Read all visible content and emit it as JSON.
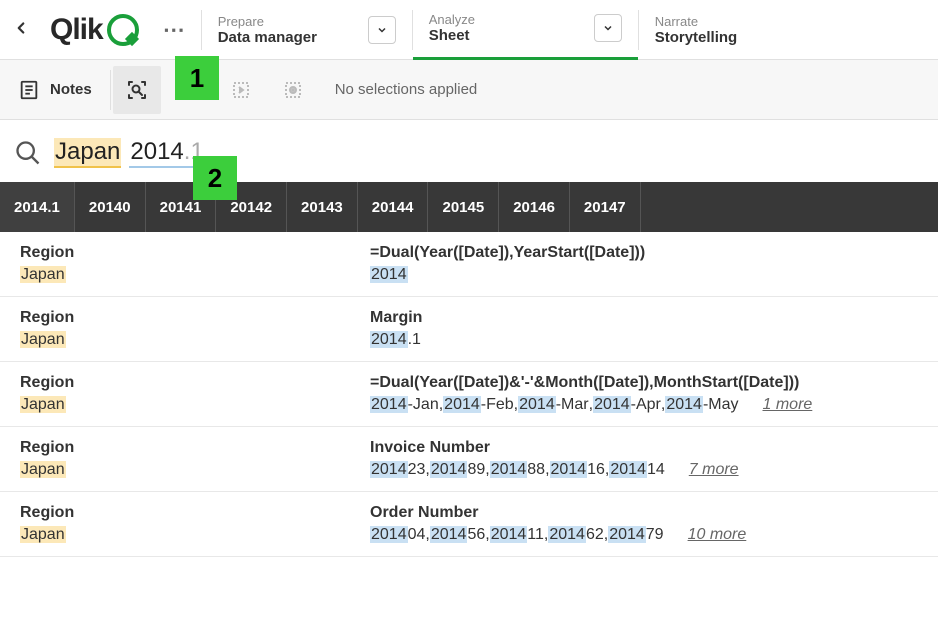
{
  "annotations": {
    "one": "1",
    "two": "2"
  },
  "nav": {
    "prepare_label": "Prepare",
    "prepare_value": "Data manager",
    "analyze_label": "Analyze",
    "analyze_value": "Sheet",
    "narrate_label": "Narrate",
    "narrate_value": "Storytelling"
  },
  "toolbar": {
    "notes": "Notes",
    "no_selections": "No selections applied"
  },
  "search": {
    "term_japan": "Japan",
    "term_2014": "2014",
    "term_suffix": ".1"
  },
  "tabs": [
    "2014.1",
    "20140",
    "20141",
    "20142",
    "20143",
    "20144",
    "20145",
    "20146",
    "20147"
  ],
  "results": [
    {
      "left_field": "Region",
      "left_value": "Japan",
      "right_field": "=Dual(Year([Date]),YearStart([Date]))",
      "right_values": [
        {
          "hl": "2014",
          "rest": ""
        }
      ]
    },
    {
      "left_field": "Region",
      "left_value": "Japan",
      "right_field": "Margin",
      "right_values": [
        {
          "hl": "2014",
          "rest": ".1"
        }
      ]
    },
    {
      "left_field": "Region",
      "left_value": "Japan",
      "right_field": "=Dual(Year([Date])&'-'&Month([Date]),MonthStart([Date]))",
      "right_values": [
        {
          "hl": "2014",
          "rest": "-Jan"
        },
        {
          "hl": "2014",
          "rest": "-Feb"
        },
        {
          "hl": "2014",
          "rest": "-Mar"
        },
        {
          "hl": "2014",
          "rest": "-Apr"
        },
        {
          "hl": "2014",
          "rest": "-May"
        }
      ],
      "more": "1 more"
    },
    {
      "left_field": "Region",
      "left_value": "Japan",
      "right_field": "Invoice Number",
      "right_values": [
        {
          "hl": "2014",
          "rest": "23"
        },
        {
          "hl": "2014",
          "rest": "89"
        },
        {
          "hl": "2014",
          "rest": "88"
        },
        {
          "hl": "2014",
          "rest": "16"
        },
        {
          "hl": "2014",
          "rest": "14"
        }
      ],
      "more": "7 more"
    },
    {
      "left_field": "Region",
      "left_value": "Japan",
      "right_field": "Order Number",
      "right_values": [
        {
          "hl": "2014",
          "rest": "04"
        },
        {
          "hl": "2014",
          "rest": "56"
        },
        {
          "hl": "2014",
          "rest": "11"
        },
        {
          "hl": "2014",
          "rest": "62"
        },
        {
          "hl": "2014",
          "rest": "79"
        }
      ],
      "more": "10 more"
    }
  ]
}
